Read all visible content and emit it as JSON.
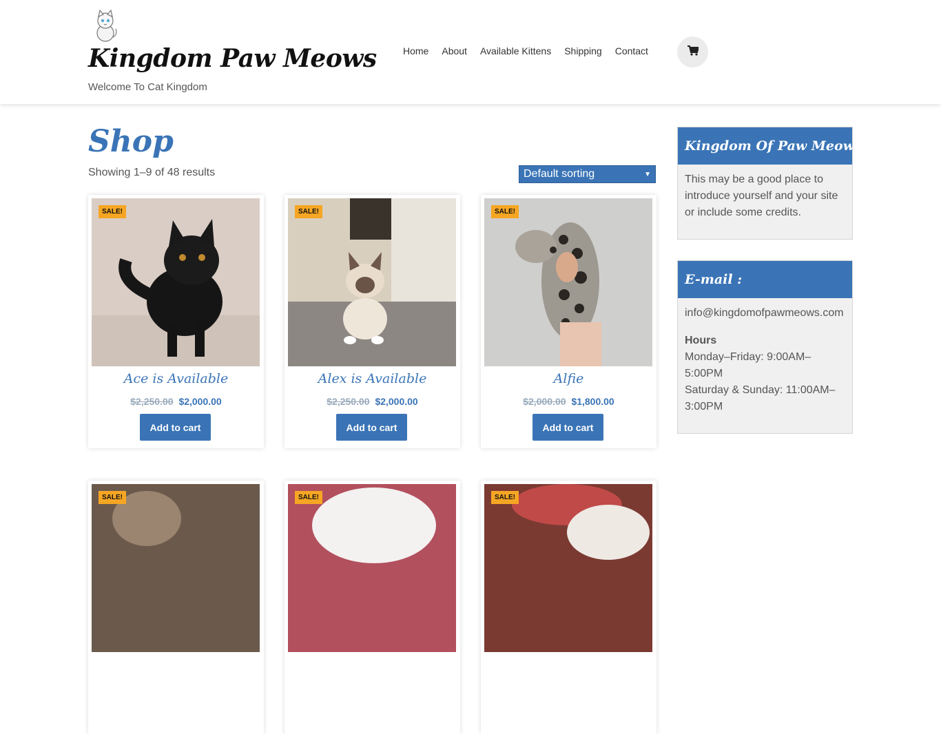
{
  "header": {
    "site_title": "Kingdom Paw Meows",
    "tagline": "Welcome To Cat Kingdom",
    "nav": [
      "Home",
      "About",
      "Available Kittens",
      "Shipping",
      "Contact"
    ],
    "cart_icon": "cart-icon"
  },
  "main": {
    "page_title": "Shop",
    "result_count": "Showing 1–9 of 48 results",
    "sort_value": "Default sorting",
    "products": [
      {
        "badge": "SALE!",
        "name": "Ace is Available",
        "old_price": "$2,250.00",
        "price": "$2,000.00",
        "button": "Add to cart"
      },
      {
        "badge": "SALE!",
        "name": "Alex is Available",
        "old_price": "$2,250.00",
        "price": "$2,000.00",
        "button": "Add to cart"
      },
      {
        "badge": "SALE!",
        "name": "Alfie",
        "old_price": "$2,000.00",
        "price": "$1,800.00",
        "button": "Add to cart"
      },
      {
        "badge": "SALE!"
      },
      {
        "badge": "SALE!"
      },
      {
        "badge": "SALE!"
      }
    ]
  },
  "sidebar": {
    "widget1": {
      "title": "Kingdom Of Paw Meows",
      "text": "This may be a good place to introduce yourself and your site or include some credits."
    },
    "widget2": {
      "title": "E-mail :",
      "email": "info@kingdomofpawmeows.com",
      "hours_label": "Hours",
      "weekday": "Monday–Friday: 9:00AM–5:00PM",
      "weekend": "Saturday & Sunday: 11:00AM–3:00PM"
    }
  },
  "colors": {
    "accent": "#3a74b6",
    "badge": "#f6a623"
  }
}
